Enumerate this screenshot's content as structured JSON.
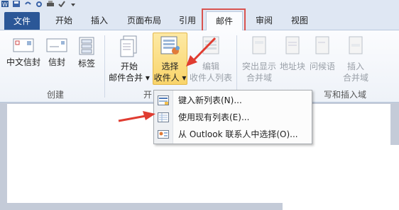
{
  "tabs": [
    {
      "label": "文件"
    },
    {
      "label": "开始"
    },
    {
      "label": "插入"
    },
    {
      "label": "页面布局"
    },
    {
      "label": "引用"
    },
    {
      "label": "邮件"
    },
    {
      "label": "审阅"
    },
    {
      "label": "视图"
    }
  ],
  "ribbon": {
    "buttons": {
      "envelope_cn": "中文信封",
      "envelope": "信封",
      "labels": "标签",
      "start_merge_1": "开始",
      "start_merge_2": "邮件合并 ▾",
      "select_recipients_1": "选择",
      "select_recipients_2": "收件人 ▾",
      "edit_recipients_1": "编辑",
      "edit_recipients_2": "收件人列表",
      "highlight_1": "突出显示",
      "highlight_2": "合并域",
      "address_block": "地址块",
      "greeting": "问候语",
      "insert_field_1": "插入",
      "insert_field_2": "合并域"
    },
    "groups": {
      "create": "创建",
      "start_partial": "开",
      "write_insert_partial": "写和插入域"
    }
  },
  "menu": {
    "items": [
      {
        "label": "键入新列表(N)..."
      },
      {
        "label": "使用现有列表(E)..."
      },
      {
        "label": "从 Outlook 联系人中选择(O)..."
      }
    ]
  },
  "colors": {
    "file_tab": "#2b5797",
    "annotation": "#d9534f",
    "selected_button": "#f9d46a"
  }
}
